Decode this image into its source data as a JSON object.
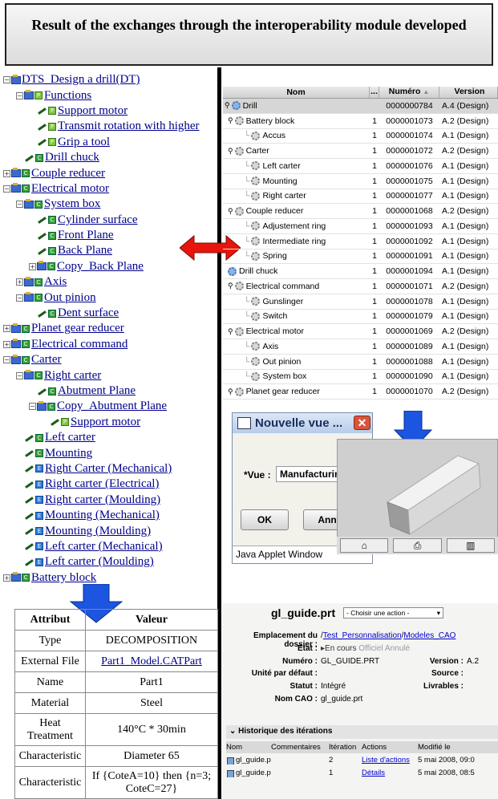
{
  "header": {
    "title": "Result of the exchanges through the interoperability module developed"
  },
  "tree": [
    {
      "label": "DTS_Design a drill(DT)",
      "indent": 0,
      "exp": "-",
      "icon": "folder",
      "badge": ""
    },
    {
      "label": "Functions",
      "indent": 1,
      "exp": "-",
      "icon": "folder",
      "badge": "p"
    },
    {
      "label": "Support motor",
      "indent": 2,
      "exp": "",
      "icon": "pen",
      "badge": "p"
    },
    {
      "label": "Transmit rotation with higher",
      "indent": 2,
      "exp": "",
      "icon": "pen",
      "badge": "p"
    },
    {
      "label": "Grip a tool",
      "indent": 2,
      "exp": "",
      "icon": "pen",
      "badge": "p"
    },
    {
      "label": "Drill chuck",
      "indent": 1,
      "exp": "",
      "icon": "pen",
      "badge": "c"
    },
    {
      "label": "Couple reducer",
      "indent": 0,
      "exp": "+",
      "icon": "folder",
      "badge": "c"
    },
    {
      "label": "Electrical motor",
      "indent": 0,
      "exp": "-",
      "icon": "folder",
      "badge": "c"
    },
    {
      "label": "System box",
      "indent": 1,
      "exp": "-",
      "icon": "folder",
      "badge": "c"
    },
    {
      "label": "Cylinder surface",
      "indent": 2,
      "exp": "",
      "icon": "pen",
      "badge": "c"
    },
    {
      "label": "Front Plane",
      "indent": 2,
      "exp": "",
      "icon": "pen",
      "badge": "c"
    },
    {
      "label": "Back Plane",
      "indent": 2,
      "exp": "",
      "icon": "pen",
      "badge": "c"
    },
    {
      "label": "Copy_Back Plane",
      "indent": 2,
      "exp": "+",
      "icon": "folder",
      "badge": "c"
    },
    {
      "label": "Axis",
      "indent": 1,
      "exp": "+",
      "icon": "folder",
      "badge": "c"
    },
    {
      "label": "Out pinion",
      "indent": 1,
      "exp": "-",
      "icon": "folder",
      "badge": "c"
    },
    {
      "label": "Dent surface",
      "indent": 2,
      "exp": "",
      "icon": "pen",
      "badge": "c"
    },
    {
      "label": "Planet gear reducer",
      "indent": 0,
      "exp": "+",
      "icon": "folder",
      "badge": "c"
    },
    {
      "label": "Electrical command",
      "indent": 0,
      "exp": "+",
      "icon": "folder",
      "badge": "c"
    },
    {
      "label": "Carter",
      "indent": 0,
      "exp": "-",
      "icon": "folder",
      "badge": "c"
    },
    {
      "label": "Right carter",
      "indent": 1,
      "exp": "-",
      "icon": "folder",
      "badge": "c"
    },
    {
      "label": "Abutment Plane",
      "indent": 2,
      "exp": "",
      "icon": "pen",
      "badge": "c"
    },
    {
      "label": "Copy_Abutment Plane",
      "indent": 2,
      "exp": "-",
      "icon": "folder",
      "badge": "c"
    },
    {
      "label": "Support motor",
      "indent": 3,
      "exp": "",
      "icon": "pen",
      "badge": "p"
    },
    {
      "label": "Left carter",
      "indent": 1,
      "exp": "",
      "icon": "pen",
      "badge": "c"
    },
    {
      "label": "Mounting",
      "indent": 1,
      "exp": "",
      "icon": "pen",
      "badge": "c"
    },
    {
      "label": "Right Carter (Mechanical)",
      "indent": 1,
      "exp": "",
      "icon": "pen",
      "badge": "e"
    },
    {
      "label": "Right carter (Electrical)",
      "indent": 1,
      "exp": "",
      "icon": "pen",
      "badge": "e"
    },
    {
      "label": "Right carter (Moulding)",
      "indent": 1,
      "exp": "",
      "icon": "pen",
      "badge": "e"
    },
    {
      "label": "Mounting (Mechanical)",
      "indent": 1,
      "exp": "",
      "icon": "pen",
      "badge": "e"
    },
    {
      "label": "Mounting (Moulding)",
      "indent": 1,
      "exp": "",
      "icon": "pen",
      "badge": "e"
    },
    {
      "label": "Left carter (Mechanical)",
      "indent": 1,
      "exp": "",
      "icon": "pen",
      "badge": "e"
    },
    {
      "label": "Left carter (Moulding)",
      "indent": 1,
      "exp": "",
      "icon": "pen",
      "badge": "e"
    },
    {
      "label": "Battery block",
      "indent": 0,
      "exp": "+",
      "icon": "folder",
      "badge": "c"
    }
  ],
  "attributes": {
    "headers": [
      "Attribut",
      "Valeur"
    ],
    "rows": [
      {
        "name": "Type",
        "value": "DECOMPOSITION",
        "link": false
      },
      {
        "name": "External File",
        "value": "Part1_Model.CATPart",
        "link": true
      },
      {
        "name": "Name",
        "value": "Part1",
        "link": false
      },
      {
        "name": "Material",
        "value": "Steel",
        "link": false
      },
      {
        "name": "Heat Treatment",
        "value": "140°C * 30min",
        "link": false
      },
      {
        "name": "Characteristic",
        "value": "Diameter 65",
        "link": false
      },
      {
        "name": "Characteristic",
        "value": "If {CoteA=10} then {n=3; CoteC=27}",
        "link": false
      }
    ]
  },
  "product_table": {
    "headers": {
      "name": "Nom",
      "dots": "...",
      "number": "Numéro",
      "version": "Version"
    },
    "rows": [
      {
        "name": "Drill",
        "level": 0,
        "qty": "",
        "number": "0000000784",
        "version": "A.4 (Design)",
        "sel": true,
        "pin": true,
        "blue": true
      },
      {
        "name": "Battery block",
        "level": 1,
        "qty": "1",
        "number": "0000001073",
        "version": "A.2 (Design)",
        "pin": true
      },
      {
        "name": "Accus",
        "level": 2,
        "qty": "1",
        "number": "0000001074",
        "version": "A.1 (Design)"
      },
      {
        "name": "Carter",
        "level": 1,
        "qty": "1",
        "number": "0000001072",
        "version": "A.2 (Design)",
        "pin": true
      },
      {
        "name": "Left carter",
        "level": 2,
        "qty": "1",
        "number": "0000001076",
        "version": "A.1 (Design)"
      },
      {
        "name": "Mounting",
        "level": 2,
        "qty": "1",
        "number": "0000001075",
        "version": "A.1 (Design)"
      },
      {
        "name": "Right carter",
        "level": 2,
        "qty": "1",
        "number": "0000001077",
        "version": "A.1 (Design)"
      },
      {
        "name": "Couple reducer",
        "level": 1,
        "qty": "1",
        "number": "0000001068",
        "version": "A.2 (Design)",
        "pin": true
      },
      {
        "name": "Adjustement ring",
        "level": 2,
        "qty": "1",
        "number": "0000001093",
        "version": "A.1 (Design)"
      },
      {
        "name": "Intermediate ring",
        "level": 2,
        "qty": "1",
        "number": "0000001092",
        "version": "A.1 (Design)"
      },
      {
        "name": "Spring",
        "level": 2,
        "qty": "1",
        "number": "0000001091",
        "version": "A.1 (Design)"
      },
      {
        "name": "Drill chuck",
        "level": 1,
        "qty": "1",
        "number": "0000001094",
        "version": "A.1 (Design)",
        "blue": true
      },
      {
        "name": "Electrical command",
        "level": 1,
        "qty": "1",
        "number": "0000001071",
        "version": "A.2 (Design)",
        "pin": true
      },
      {
        "name": "Gunslinger",
        "level": 2,
        "qty": "1",
        "number": "0000001078",
        "version": "A.1 (Design)"
      },
      {
        "name": "Switch",
        "level": 2,
        "qty": "1",
        "number": "0000001079",
        "version": "A.1 (Design)"
      },
      {
        "name": "Electrical motor",
        "level": 1,
        "qty": "1",
        "number": "0000001069",
        "version": "A.2 (Design)",
        "pin": true
      },
      {
        "name": "Axis",
        "level": 2,
        "qty": "1",
        "number": "0000001089",
        "version": "A.1 (Design)"
      },
      {
        "name": "Out pinion",
        "level": 2,
        "qty": "1",
        "number": "0000001088",
        "version": "A.1 (Design)"
      },
      {
        "name": "System box",
        "level": 2,
        "qty": "1",
        "number": "0000001090",
        "version": "A.1 (Design)"
      },
      {
        "name": "Planet gear reducer",
        "level": 1,
        "qty": "1",
        "number": "0000001070",
        "version": "A.2 (Design)",
        "pin": true
      }
    ]
  },
  "dialog": {
    "title": "Nouvelle vue ...",
    "vue_label": "*Vue :",
    "vue_value": "Manufacturin",
    "ok_label": "OK",
    "cancel_label": "Ann",
    "footer": "Java Applet Window"
  },
  "form": {
    "title": "gl_guide.prt",
    "action_placeholder": "- Choisir une action -",
    "emplacement_label": "Emplacement du dossier :",
    "emplacement_prefix": "/",
    "emplacement_link1": "Test_Personnalisation",
    "emplacement_sep": "/",
    "emplacement_link2": "Modeles_CAO",
    "etat_label": "Etat :",
    "etat_values": [
      "En cours",
      "Officiel",
      "Annulé"
    ],
    "numero_label": "Numéro :",
    "numero_value": "GL_GUIDE.PRT",
    "version_label": "Version :",
    "version_value": "A.2",
    "unite_label": "Unité par défaut :",
    "source_label": "Source :",
    "statut_label": "Statut :",
    "statut_value": "Intégré",
    "livrables_label": "Livrables :",
    "nomcao_label": "Nom CAO :",
    "nomcao_value": "gl_guide.prt",
    "history_title": "Historique des itérations",
    "history_headers": [
      "Nom",
      "Commentaires",
      "Itération",
      "Actions",
      "Modifié le"
    ],
    "history_rows": [
      {
        "nom": "gl_guide.prt",
        "comm": "",
        "iter": "2",
        "action": "Liste d'actions",
        "date": "5 mai 2008, 09:0"
      },
      {
        "nom": "gl_guide.prt",
        "comm": "",
        "iter": "1",
        "action": "Détails",
        "date": "5 mai 2008, 08:5"
      }
    ]
  },
  "colors": {
    "arrow_red": "#e8150c",
    "arrow_blue": "#1b55e0",
    "link": "#00008b"
  }
}
